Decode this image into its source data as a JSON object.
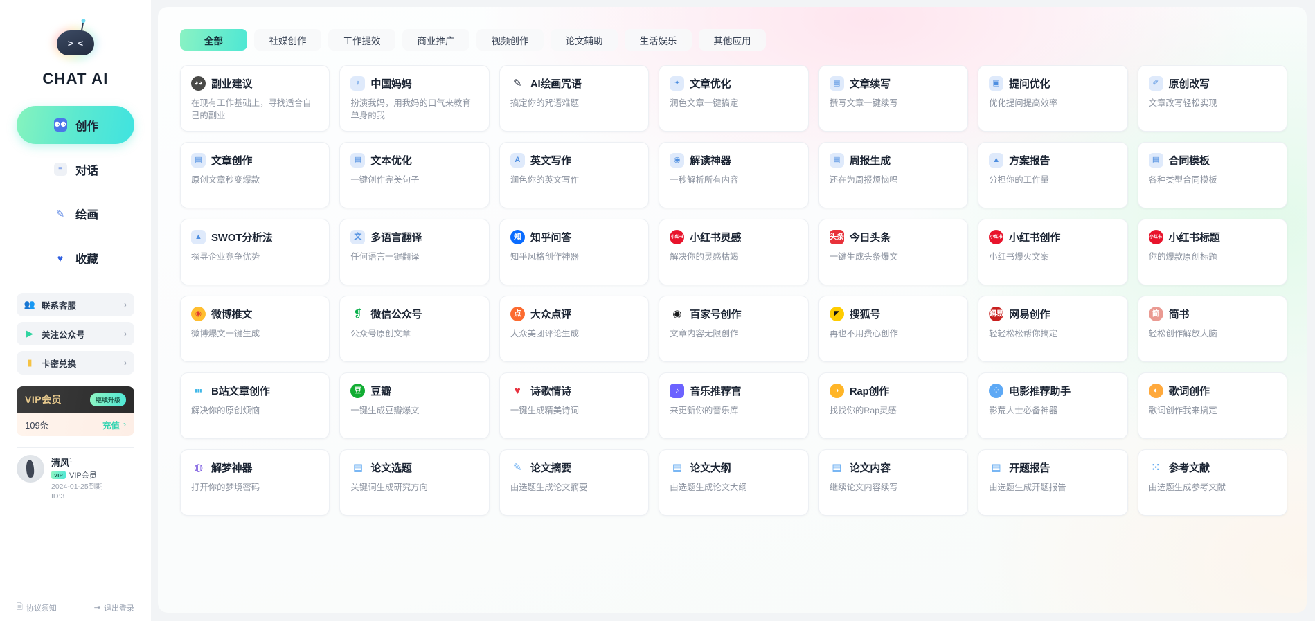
{
  "brand": {
    "name": "CHAT AI",
    "logo_icon": "robot-logo"
  },
  "sidebar": {
    "nav": [
      {
        "label": "创作",
        "icon": "robot-icon",
        "active": true
      },
      {
        "label": "对话",
        "icon": "chat-icon",
        "active": false
      },
      {
        "label": "绘画",
        "icon": "brush-icon",
        "active": false
      },
      {
        "label": "收藏",
        "icon": "heart-icon",
        "active": false
      }
    ],
    "links": [
      {
        "label": "联系客服",
        "icon": "support-icon",
        "chevron": "›"
      },
      {
        "label": "关注公众号",
        "icon": "wechat-play-icon",
        "chevron": "›"
      },
      {
        "label": "卡密兑换",
        "icon": "card-icon",
        "chevron": "›"
      }
    ],
    "vip": {
      "title": "VIP会员",
      "badge": "继续升级"
    },
    "credit": {
      "count": "109条",
      "topup": "充值",
      "chevron": "›"
    },
    "user": {
      "name": "清风",
      "level": "1",
      "vip_tag": "VIP",
      "vip_label": "VIP会员",
      "expiry": "2024-01-25到期",
      "id": "ID:3"
    },
    "footer": {
      "agreement": "协议须知",
      "agreement_icon": "doc-icon",
      "logout": "退出登录",
      "logout_icon": "logout-icon"
    }
  },
  "tabs": [
    {
      "label": "全部",
      "active": true
    },
    {
      "label": "社媒创作",
      "active": false
    },
    {
      "label": "工作提效",
      "active": false
    },
    {
      "label": "商业推广",
      "active": false
    },
    {
      "label": "视频创作",
      "active": false
    },
    {
      "label": "论文辅助",
      "active": false
    },
    {
      "label": "生活娱乐",
      "active": false
    },
    {
      "label": "其他应用",
      "active": false
    }
  ],
  "cards": [
    {
      "title": "副业建议",
      "desc": "在现有工作基础上，寻找适合自己的副业",
      "icon": "panda-icon",
      "icon_style": "round",
      "bg": "#4a4a48",
      "fg": "#ffffff",
      "glyph": "◕◕"
    },
    {
      "title": "中国妈妈",
      "desc": "扮演我妈，用我妈的口气来教育单身的我",
      "icon": "mother-icon",
      "icon_style": "pale",
      "bg": "#dfeafb",
      "fg": "#4f8fe0",
      "glyph": "♀"
    },
    {
      "title": "AI绘画咒语",
      "desc": "搞定你的咒语难题",
      "icon": "feather-pen-icon",
      "icon_style": "plain",
      "bg": "transparent",
      "fg": "#3a4150",
      "glyph": "✎"
    },
    {
      "title": "文章优化",
      "desc": "润色文章一键搞定",
      "icon": "edit-doc-icon",
      "icon_style": "pale",
      "bg": "#dfeafb",
      "fg": "#4f8fe0",
      "glyph": "✦"
    },
    {
      "title": "文章续写",
      "desc": "撰写文章一键续写",
      "icon": "doc-check-icon",
      "icon_style": "pale",
      "bg": "#dfeafb",
      "fg": "#4f8fe0",
      "glyph": "▤"
    },
    {
      "title": "提问优化",
      "desc": "优化提问提高效率",
      "icon": "question-opt-icon",
      "icon_style": "pale",
      "bg": "#dfeafb",
      "fg": "#4f8fe0",
      "glyph": "▣"
    },
    {
      "title": "原创改写",
      "desc": "文章改写轻松实现",
      "icon": "rewrite-icon",
      "icon_style": "pale",
      "bg": "#dfeafb",
      "fg": "#4f8fe0",
      "glyph": "✐"
    },
    {
      "title": "文章创作",
      "desc": "原创文章秒变爆款",
      "icon": "article-icon",
      "icon_style": "pale",
      "bg": "#dfeafb",
      "fg": "#4f8fe0",
      "glyph": "▤"
    },
    {
      "title": "文本优化",
      "desc": "一键创作完美句子",
      "icon": "text-opt-icon",
      "icon_style": "pale",
      "bg": "#dfeafb",
      "fg": "#4f8fe0",
      "glyph": "▤"
    },
    {
      "title": "英文写作",
      "desc": "润色你的英文写作",
      "icon": "english-write-icon",
      "icon_style": "pale",
      "bg": "#dfeafb",
      "fg": "#4f8fe0",
      "glyph": "A"
    },
    {
      "title": "解读神器",
      "desc": "一秒解析所有内容",
      "icon": "analyze-icon",
      "icon_style": "pale",
      "bg": "#dfeafb",
      "fg": "#4f8fe0",
      "glyph": "◉"
    },
    {
      "title": "周报生成",
      "desc": "还在为周报烦恼吗",
      "icon": "weekly-report-icon",
      "icon_style": "pale",
      "bg": "#dfeafb",
      "fg": "#4f8fe0",
      "glyph": "▤"
    },
    {
      "title": "方案报告",
      "desc": "分担你的工作量",
      "icon": "plan-report-icon",
      "icon_style": "pale",
      "bg": "#dfeafb",
      "fg": "#4f8fe0",
      "glyph": "▲"
    },
    {
      "title": "合同模板",
      "desc": "各种类型合同模板",
      "icon": "contract-icon",
      "icon_style": "pale",
      "bg": "#dfeafb",
      "fg": "#4f8fe0",
      "glyph": "▤"
    },
    {
      "title": "SWOT分析法",
      "desc": "探寻企业竞争优势",
      "icon": "swot-icon",
      "icon_style": "pale",
      "bg": "#dfeafb",
      "fg": "#4f8fe0",
      "glyph": "▲"
    },
    {
      "title": "多语言翻译",
      "desc": "任何语言一键翻译",
      "icon": "translate-icon",
      "icon_style": "pale",
      "bg": "#dfeafb",
      "fg": "#4f8fe0",
      "glyph": "文"
    },
    {
      "title": "知乎问答",
      "desc": "知乎风格创作神器",
      "icon": "zhihu-icon",
      "icon_style": "round",
      "bg": "#0a6cff",
      "fg": "#ffffff",
      "glyph": "知"
    },
    {
      "title": "小红书灵感",
      "desc": "解决你的灵感枯竭",
      "icon": "xiaohongshu-icon",
      "icon_style": "round",
      "bg": "#e8142c",
      "fg": "#ffffff",
      "glyph": "小红书"
    },
    {
      "title": "今日头条",
      "desc": "一键生成头条爆文",
      "icon": "toutiao-icon",
      "icon_style": "",
      "bg": "#e8313a",
      "fg": "#ffffff",
      "glyph": "头条"
    },
    {
      "title": "小红书创作",
      "desc": "小红书爆火文案",
      "icon": "xiaohongshu-icon",
      "icon_style": "round",
      "bg": "#e8142c",
      "fg": "#ffffff",
      "glyph": "小红书"
    },
    {
      "title": "小红书标题",
      "desc": "你的爆款原创标题",
      "icon": "xiaohongshu-icon",
      "icon_style": "round",
      "bg": "#e8142c",
      "fg": "#ffffff",
      "glyph": "小红书"
    },
    {
      "title": "微博推文",
      "desc": "微博爆文一键生成",
      "icon": "weibo-icon",
      "icon_style": "round",
      "bg": "#ffbe30",
      "fg": "#e03a2f",
      "glyph": "◉"
    },
    {
      "title": "微信公众号",
      "desc": "公众号原创文章",
      "icon": "wechat-mp-icon",
      "icon_style": "plain",
      "bg": "transparent",
      "fg": "#0bb14d",
      "glyph": "❡"
    },
    {
      "title": "大众点评",
      "desc": "大众美团评论生成",
      "icon": "dianping-icon",
      "icon_style": "round",
      "bg": "#fc6b30",
      "fg": "#ffffff",
      "glyph": "点"
    },
    {
      "title": "百家号创作",
      "desc": "文章内容无限创作",
      "icon": "baijiahao-icon",
      "icon_style": "plain",
      "bg": "transparent",
      "fg": "#18191b",
      "glyph": "◉"
    },
    {
      "title": "搜狐号",
      "desc": "再也不用费心创作",
      "icon": "sohu-icon",
      "icon_style": "round",
      "bg": "#ffcc00",
      "fg": "#111111",
      "glyph": "◤"
    },
    {
      "title": "网易创作",
      "desc": "轻轻松松帮你搞定",
      "icon": "netease-icon",
      "icon_style": "round",
      "bg": "#c8201f",
      "fg": "#ffffff",
      "glyph": "網易"
    },
    {
      "title": "简书",
      "desc": "轻松创作解放大脑",
      "icon": "jianshu-icon",
      "icon_style": "round",
      "bg": "#ea9a92",
      "fg": "#ffffff",
      "glyph": "简"
    },
    {
      "title": "B站文章创作",
      "desc": "解决你的原创烦恼",
      "icon": "bilibili-icon",
      "icon_style": "plain",
      "bg": "transparent",
      "fg": "#3fb7e8",
      "glyph": "▮▮▮"
    },
    {
      "title": "豆瓣",
      "desc": "一键生成豆瓣爆文",
      "icon": "douban-icon",
      "icon_style": "round",
      "bg": "#12ad33",
      "fg": "#ffffff",
      "glyph": "豆"
    },
    {
      "title": "诗歌情诗",
      "desc": "一键生成精美诗词",
      "icon": "heart-icon",
      "icon_style": "plain",
      "bg": "transparent",
      "fg": "#e8323f",
      "glyph": "♥"
    },
    {
      "title": "音乐推荐官",
      "desc": "来更新你的音乐库",
      "icon": "music-icon",
      "icon_style": "",
      "bg": "#6c63ff",
      "fg": "#ffffff",
      "glyph": "♪"
    },
    {
      "title": "Rap创作",
      "desc": "找找你的Rap灵感",
      "icon": "rap-speaker-icon",
      "icon_style": "round",
      "bg": "#ffb527",
      "fg": "#ffffff",
      "glyph": "◑"
    },
    {
      "title": "电影推荐助手",
      "desc": "影荒人士必备神器",
      "icon": "film-icon",
      "icon_style": "round",
      "bg": "#5ea9f5",
      "fg": "#ffffff",
      "glyph": "⁘"
    },
    {
      "title": "歌词创作",
      "desc": "歌词创作我来搞定",
      "icon": "lyrics-icon",
      "icon_style": "round",
      "bg": "#ffa93c",
      "fg": "#ffffff",
      "glyph": "◐"
    },
    {
      "title": "解梦神器",
      "desc": "打开你的梦境密码",
      "icon": "dream-icon",
      "icon_style": "plain",
      "bg": "transparent",
      "fg": "#7c5ce0",
      "glyph": "◍"
    },
    {
      "title": "论文选题",
      "desc": "关键词生成研究方向",
      "icon": "paper-topic-icon",
      "icon_style": "plain",
      "bg": "transparent",
      "fg": "#6aaef2",
      "glyph": "▤"
    },
    {
      "title": "论文摘要",
      "desc": "由选题生成论文摘要",
      "icon": "paper-abstract-icon",
      "icon_style": "plain",
      "bg": "transparent",
      "fg": "#6aaef2",
      "glyph": "✎"
    },
    {
      "title": "论文大纲",
      "desc": "由选题生成论文大纲",
      "icon": "paper-outline-icon",
      "icon_style": "plain",
      "bg": "transparent",
      "fg": "#6aaef2",
      "glyph": "▤"
    },
    {
      "title": "论文内容",
      "desc": "继续论文内容续写",
      "icon": "paper-content-icon",
      "icon_style": "plain",
      "bg": "transparent",
      "fg": "#6aaef2",
      "glyph": "▤"
    },
    {
      "title": "开题报告",
      "desc": "由选题生成开题报告",
      "icon": "proposal-icon",
      "icon_style": "plain",
      "bg": "transparent",
      "fg": "#6aaef2",
      "glyph": "▤"
    },
    {
      "title": "参考文献",
      "desc": "由选题生成参考文献",
      "icon": "reference-icon",
      "icon_style": "plain",
      "bg": "transparent",
      "fg": "#6aaef2",
      "glyph": "⁙"
    }
  ],
  "colors": {
    "accent": "#4ee7d4",
    "accent2": "#8af2c3",
    "sidebar_bg": "#ffffff",
    "page_bg": "#f2f4f6",
    "title": "#1b2433",
    "muted": "#8d94a1"
  }
}
